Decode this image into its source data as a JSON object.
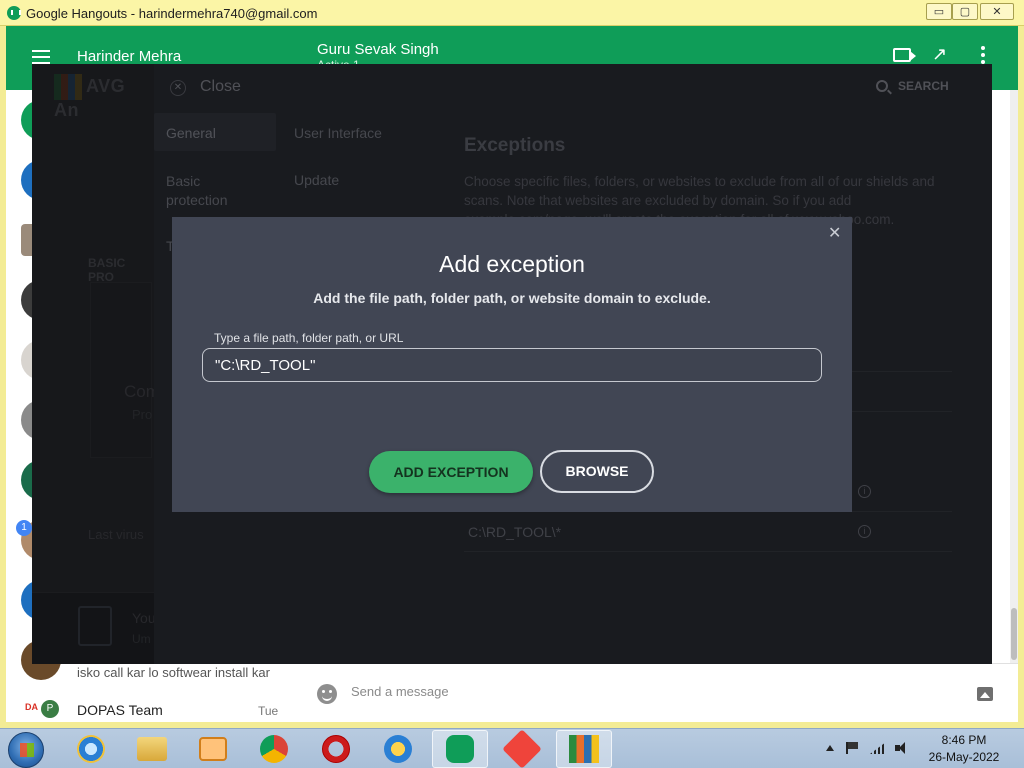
{
  "window": {
    "title": "Google Hangouts - harindermehra740@gmail.com",
    "min": "▭",
    "max": "▢",
    "close": "✕"
  },
  "hangouts": {
    "user_name": "Harinder Mehra",
    "contact_name": "Guru Sevak Singh",
    "contact_status": "Active 1",
    "last_message": "isko call kar lo softwear install kar",
    "unread_badge": "1",
    "group_name": "DOPAS Team",
    "group_time": "Tue",
    "group_initial": "P",
    "group_tag": "DA",
    "message_placeholder": "Send a message",
    "accent": "#0f9d58"
  },
  "avg": {
    "logo": "AVG An",
    "close_label": "Close",
    "search_label": "SEARCH",
    "tabs": [
      {
        "label": "General"
      },
      {
        "label": "User Interface"
      },
      {
        "label": "Basic protection"
      },
      {
        "label": "Update"
      },
      {
        "label": "T"
      }
    ],
    "exceptions_title": "Exceptions",
    "exceptions_desc": "Choose specific files, folders, or websites to exclude from all of our shields and scans. Note that websites are excluded by domain. So if you add example.com/page, we'll create the exception for all of www.yahoo.com.",
    "exception_row": "C:\\RD_TOOL\\*",
    "basic_protection": "BASIC PRO",
    "card_text": "Com",
    "card_subtext": "Pro",
    "last_virus": "Last virus",
    "promo_title": "You",
    "promo_sub": "Um"
  },
  "modal": {
    "title": "Add exception",
    "subtitle": "Add the file path, folder path, or website domain to exclude.",
    "field_label": "Type a file path, folder path, or URL",
    "field_value": "\"C:\\RD_TOOL\"",
    "add_button": "ADD EXCEPTION",
    "browse_button": "BROWSE",
    "close": "✕",
    "add_color": "#3bb26b"
  },
  "taskbar": {
    "time": "8:46 PM",
    "date": "26-May-2022",
    "apps": [
      "internet-explorer",
      "windows-explorer",
      "media-player",
      "chrome",
      "opera",
      "key-manager",
      "hangouts",
      "anydesk",
      "avg"
    ]
  }
}
